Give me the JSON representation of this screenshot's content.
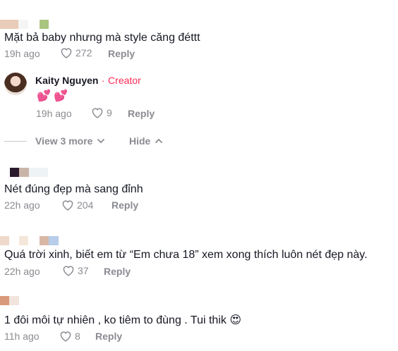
{
  "comments": [
    {
      "text": "Mặt bả baby nhưng mà style căng đéttt",
      "time": "19h ago",
      "likes": "272",
      "reply_label": "Reply",
      "swatches": [
        "#e8cbb8",
        "#f5f5f5",
        "#a9c47f"
      ]
    },
    {
      "text": "Nét đúng đẹp mà sang đỉnh",
      "time": "22h ago",
      "likes": "204",
      "reply_label": "Reply",
      "swatches": [
        "#2a1a2e",
        "#c9b5a8",
        "#eef3f6"
      ]
    },
    {
      "text": "Quá trời xinh, biết em từ “Em chưa 18” xem xong thích luôn nét đẹp này.",
      "time": "22h ago",
      "likes": "37",
      "reply_label": "Reply",
      "swatches": [
        "#efd9cc",
        "#f4e7da",
        "#d9b7a6",
        "#b7cde9"
      ]
    },
    {
      "text": "1 đôi môi tự nhiên , ko tiêm to đùng . Tui thik 😍",
      "time": "11h ago",
      "likes": "8",
      "reply_label": "Reply",
      "swatches": [
        "#d89a7a",
        "#f1e4dc"
      ]
    }
  ],
  "creator_reply": {
    "name": "Kaity Nguyen",
    "separator": "·",
    "tag": "Creator",
    "text": "💕 💕",
    "time": "19h ago",
    "likes": "9",
    "reply_label": "Reply"
  },
  "thread_controls": {
    "view_more_label": "View 3 more",
    "hide_label": "Hide"
  },
  "colors": {
    "accent": "#fe2c55",
    "muted": "#8a8b91",
    "text": "#161823"
  }
}
